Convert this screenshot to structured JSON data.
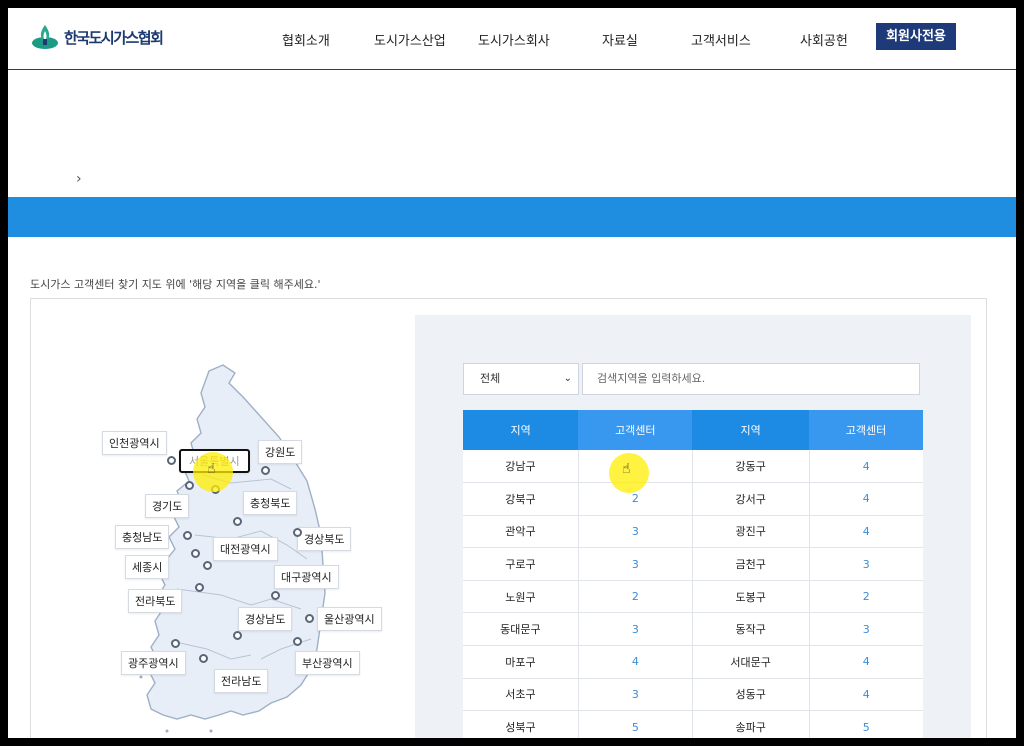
{
  "header": {
    "logo_text": "한국도시가스협회",
    "nav": [
      "협회소개",
      "도시가스산업",
      "도시가스회사",
      "자료실",
      "고객서비스",
      "사회공헌"
    ],
    "member_button": "회원사전용"
  },
  "breadcrumb": "›",
  "guide_text": "도시가스 고객센터 찾기 지도 위에 '해당 지역을 클릭 해주세요.'",
  "map": {
    "regions": [
      "인천광역시",
      "서울특별시",
      "강원도",
      "경기도",
      "충청북도",
      "충청남도",
      "경상북도",
      "대전광역시",
      "세종시",
      "대구광역시",
      "전라북도",
      "경상남도",
      "울산광역시",
      "광주광역시",
      "부산광역시",
      "전라남도"
    ],
    "selected": "서울특별시"
  },
  "filter": {
    "select_value": "전체",
    "search_placeholder": "검색지역을 입력하세요."
  },
  "table": {
    "headers": [
      "지역",
      "고객센터",
      "지역",
      "고객센터"
    ],
    "rows": [
      [
        "강남구",
        "",
        "강동구",
        "4"
      ],
      [
        "강북구",
        "2",
        "강서구",
        "4"
      ],
      [
        "관악구",
        "3",
        "광진구",
        "4"
      ],
      [
        "구로구",
        "3",
        "금천구",
        "3"
      ],
      [
        "노원구",
        "2",
        "도봉구",
        "2"
      ],
      [
        "동대문구",
        "3",
        "동작구",
        "3"
      ],
      [
        "마포구",
        "4",
        "서대문구",
        "4"
      ],
      [
        "서초구",
        "3",
        "성동구",
        "4"
      ],
      [
        "성북구",
        "5",
        "송파구",
        "5"
      ]
    ]
  },
  "colors": {
    "brand_navy": "#1e3a78",
    "accent_blue": "#1f8de0",
    "header_cell": "#1d8ae3",
    "link_number": "#3a8ed8",
    "cursor_highlight": "#ffee00"
  }
}
